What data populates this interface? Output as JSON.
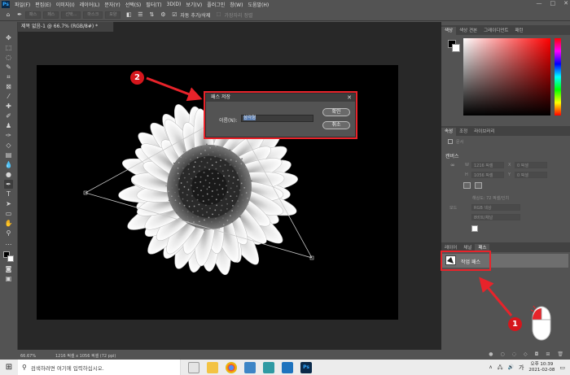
{
  "app": {
    "logo": "Ps"
  },
  "menu": [
    "파일(F)",
    "편집(E)",
    "이미지(I)",
    "레이어(L)",
    "문자(Y)",
    "선택(S)",
    "필터(T)",
    "3D(D)",
    "보기(V)",
    "플러그인",
    "창(W)",
    "도움말(H)"
  ],
  "window_controls": {
    "min": "—",
    "max": "□",
    "close": "✕"
  },
  "options_bar": {
    "fields": [
      "패스",
      "페스",
      "개체 끌기",
      "선택...",
      "마스크",
      "모양"
    ],
    "auto_add_delete": "자동 추가/삭제",
    "align_edges": "가장자리 정렬"
  },
  "document": {
    "tab_title": "제목 없음-1 @ 66.7% (RGB/8#) *",
    "zoom": "66.67%",
    "doc_info": "1216 픽셀 x 1056 픽셀 (72 ppi)"
  },
  "panels": {
    "color_tabs": [
      "색상",
      "색상 견본",
      "그레이디언트",
      "패턴"
    ],
    "properties_tabs": [
      "속성",
      "조정",
      "라이브러리"
    ],
    "properties": {
      "type_label": "문서",
      "section": "캔버스",
      "w_label": "W",
      "w_value": "1216 픽셀",
      "h_label": "H",
      "h_value": "1056 픽셀",
      "x_label": "X",
      "x_value": "0 픽셀",
      "y_label": "Y",
      "y_value": "0 픽셀",
      "resolution": "해상도: 72 픽셀/인치",
      "mode_label": "모드",
      "mode_value": "RGB 색상",
      "depth_value": "8비트/채널"
    },
    "layers_tabs": [
      "레이어",
      "채널",
      "패스"
    ],
    "path_item": "작업 패스"
  },
  "dialog": {
    "title": "패스 저장",
    "name_label": "이름(N):",
    "name_value": "삼각형",
    "ok_label": "확인",
    "cancel_label": "취소"
  },
  "annotations": {
    "step1": "1",
    "step2": "2"
  },
  "taskbar": {
    "search_placeholder": "검색하려면 여기에 입력하십시오.",
    "time": "오후 10:39",
    "date": "2021-02-08",
    "lang": "가"
  },
  "colors": {
    "accent_red": "#e8232a",
    "ps_blue": "#31a8ff",
    "panel_bg": "#535353",
    "workspace_bg": "#282828"
  }
}
